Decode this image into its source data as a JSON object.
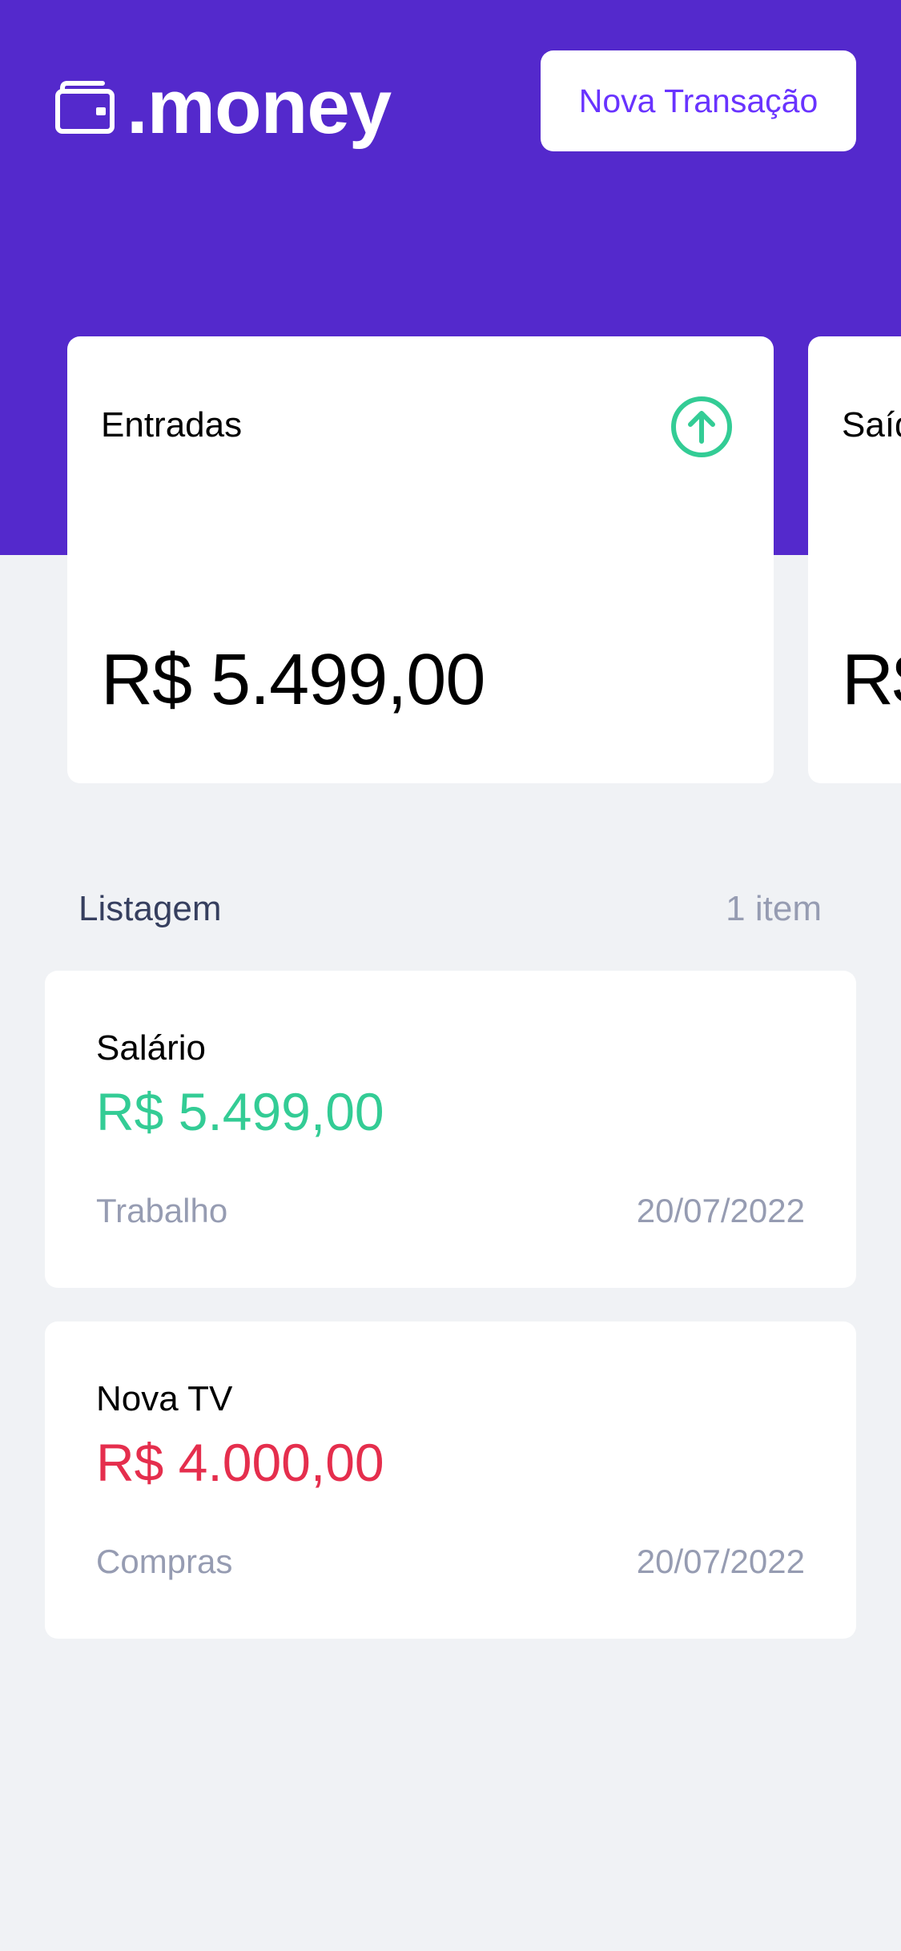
{
  "header": {
    "logo_text": ".money",
    "logo_icon": "wallet-icon",
    "new_transaction_label": "Nova Transação"
  },
  "summary": {
    "cards": [
      {
        "title": "Entradas",
        "icon": "arrow-up-circle-icon",
        "amount": "R$ 5.499,00"
      },
      {
        "title": "Saíd",
        "amount": "R$"
      }
    ]
  },
  "listing": {
    "title": "Listagem",
    "count": "1 item"
  },
  "transactions": [
    {
      "title": "Salário",
      "amount": "R$ 5.499,00",
      "type": "income",
      "category": "Trabalho",
      "date": "20/07/2022"
    },
    {
      "title": "Nova TV",
      "amount": "R$ 4.000,00",
      "type": "outcome",
      "category": "Compras",
      "date": "20/07/2022"
    }
  ],
  "colors": {
    "primary": "#5429CC",
    "button_text": "#6933FF",
    "income": "#33CC95",
    "outcome": "#E52E4D",
    "background": "#F0F2F5",
    "muted": "#969CB2",
    "title": "#363F5F"
  }
}
